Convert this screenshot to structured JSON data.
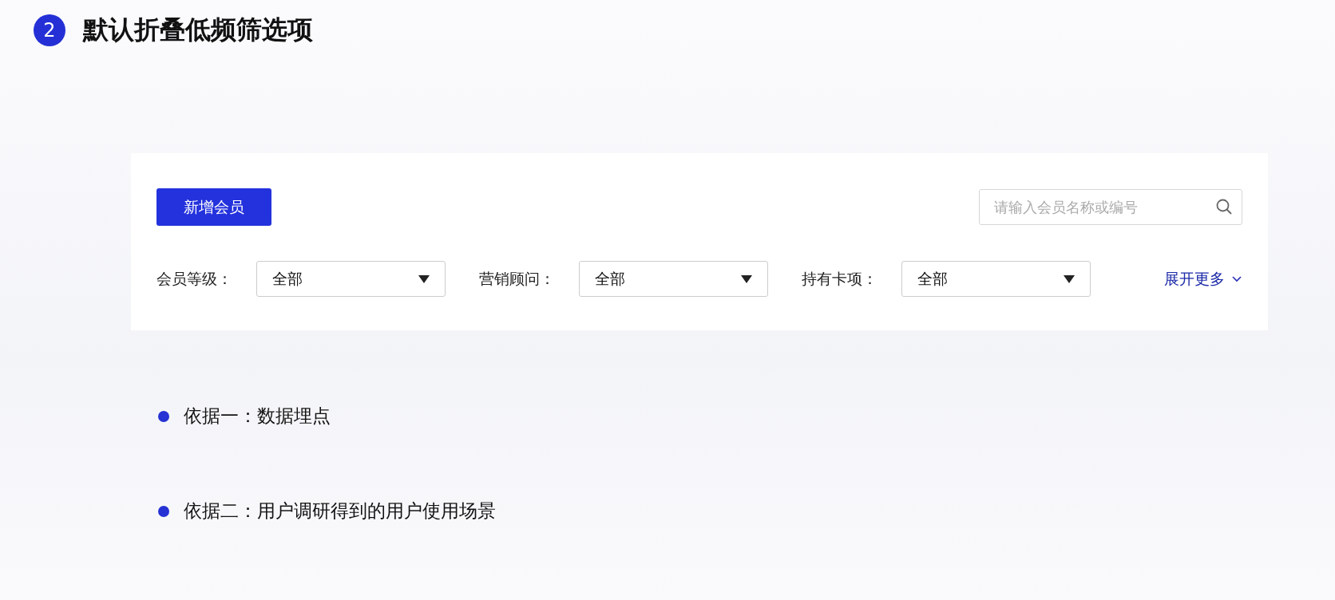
{
  "heading": {
    "number": "2",
    "title": "默认折叠低频筛选项"
  },
  "panel": {
    "add_button": "新增会员",
    "search": {
      "placeholder": "请输入会员名称或编号"
    },
    "filters": [
      {
        "label": "会员等级：",
        "value": "全部"
      },
      {
        "label": "营销顾问：",
        "value": "全部"
      },
      {
        "label": "持有卡项：",
        "value": "全部"
      }
    ],
    "expand_link": "展开更多"
  },
  "bullets": [
    "依据一：数据埋点",
    "依据二：用户调研得到的用户使用场景"
  ]
}
